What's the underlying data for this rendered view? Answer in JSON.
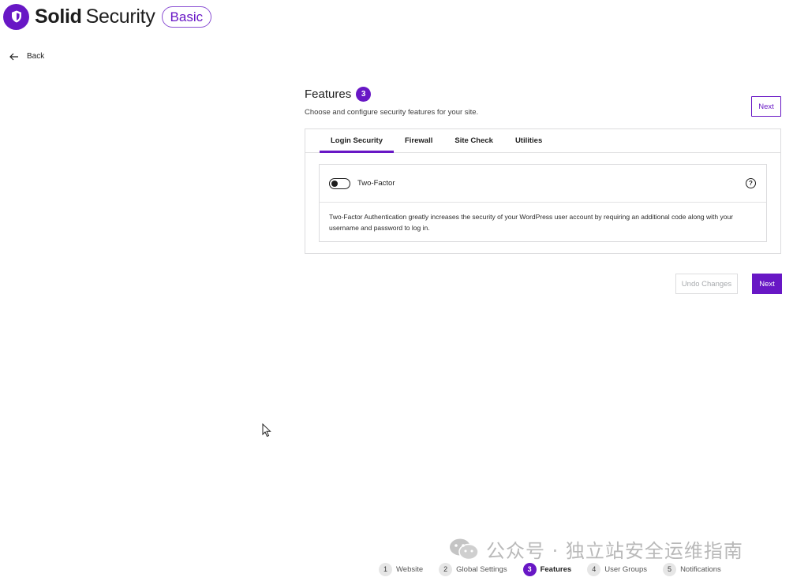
{
  "brand": {
    "name_bold": "Solid",
    "name_regular": "Security",
    "plan_badge": "Basic",
    "accent_color": "#6817c5"
  },
  "nav": {
    "back_label": "Back"
  },
  "main": {
    "title": "Features",
    "step_number": "3",
    "subtitle": "Choose and configure security features for your site.",
    "next_top_label": "Next",
    "tabs": [
      {
        "label": "Login Security",
        "active": true
      },
      {
        "label": "Firewall",
        "active": false
      },
      {
        "label": "Site Check",
        "active": false
      },
      {
        "label": "Utilities",
        "active": false
      }
    ],
    "feature": {
      "name": "Two-Factor",
      "enabled": false,
      "help_icon": "?",
      "description": "Two-Factor Authentication greatly increases the security of your WordPress user account by requiring an additional code along with your username and password to log in."
    },
    "undo_label": "Undo Changes",
    "next_bottom_label": "Next"
  },
  "watermark": {
    "text": "公众号 · 独立站安全运维指南"
  },
  "stepper": [
    {
      "num": "1",
      "label": "Website",
      "active": false
    },
    {
      "num": "2",
      "label": "Global Settings",
      "active": false
    },
    {
      "num": "3",
      "label": "Features",
      "active": true
    },
    {
      "num": "4",
      "label": "User Groups",
      "active": false
    },
    {
      "num": "5",
      "label": "Notifications",
      "active": false
    }
  ]
}
